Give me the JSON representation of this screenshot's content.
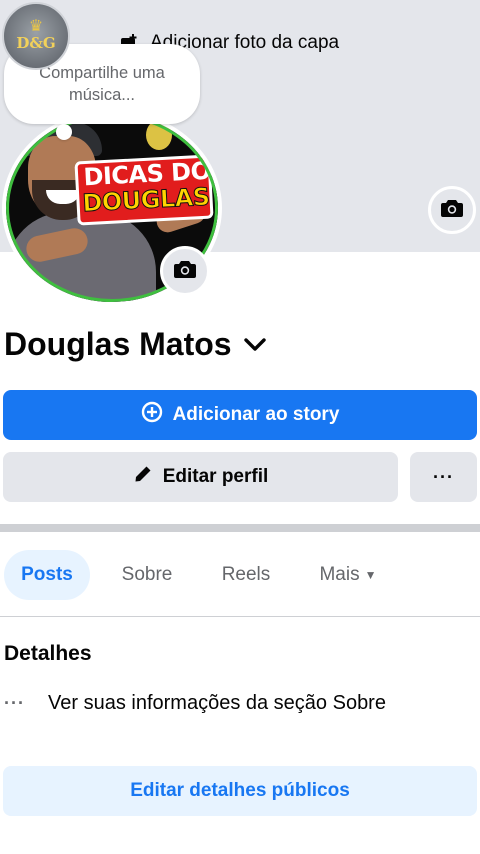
{
  "cover": {
    "add_cover_label": "Adicionar foto da capa",
    "add_icon": "photo-add-icon",
    "camera_icon": "camera-icon"
  },
  "app_badge": {
    "text": "D&G"
  },
  "note_bubble": {
    "text": "Compartilhe uma música..."
  },
  "avatar": {
    "title_line1": "DICAS DO",
    "title_line2": "DOUGLAS",
    "camera_icon": "camera-icon"
  },
  "profile": {
    "name": "Douglas Matos",
    "switch_icon": "chevron-down-icon"
  },
  "actions": {
    "add_story_label": "Adicionar ao story",
    "add_story_icon": "plus-circle-icon",
    "edit_profile_label": "Editar perfil",
    "edit_profile_icon": "pencil-icon",
    "more_label": "···"
  },
  "tabs": [
    {
      "label": "Posts",
      "active": true
    },
    {
      "label": "Sobre",
      "active": false
    },
    {
      "label": "Reels",
      "active": false
    },
    {
      "label": "Mais",
      "active": false
    }
  ],
  "details": {
    "title": "Detalhes",
    "row_icon": "···",
    "row_text": "Ver suas informações da seção Sobre",
    "edit_public_label": "Editar detalhes públicos"
  },
  "colors": {
    "primary": "#1877f2",
    "primary_light": "#e7f3ff",
    "button_gray": "#e4e6eb",
    "text": "#050505",
    "muted": "#65676b"
  }
}
